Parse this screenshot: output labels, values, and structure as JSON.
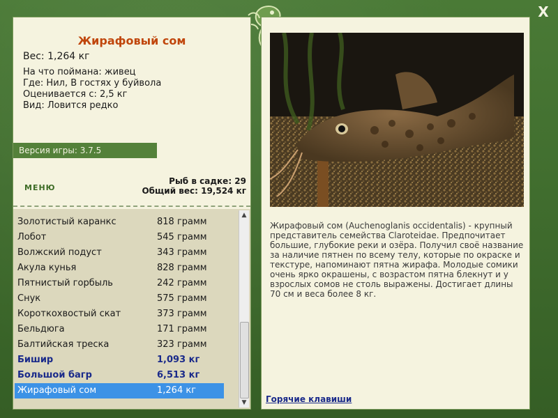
{
  "close_label": "X",
  "fish": {
    "title": "Жирафовый сом",
    "weight": "Вес: 1,264 кг",
    "bait": "На что поймана: живец",
    "location": "Где: Нил, В гостях у буйвола",
    "valued_from": "Оценивается с: 2,5 кг",
    "rarity": "Вид: Ловится редко"
  },
  "version": "Версия игры: 3.7.5",
  "menu_label": "МЕНЮ",
  "stats": {
    "fish_count": "Рыб в садке: 29",
    "total_weight": "Общий вес: 19,524 кг"
  },
  "catch_list": [
    {
      "name": "Золотистый каранкс",
      "weight": "818 грамм",
      "big": false,
      "selected": false
    },
    {
      "name": "Лобот",
      "weight": "545 грамм",
      "big": false,
      "selected": false
    },
    {
      "name": "Волжский подуст",
      "weight": "343 грамм",
      "big": false,
      "selected": false
    },
    {
      "name": "Акула кунья",
      "weight": "828 грамм",
      "big": false,
      "selected": false
    },
    {
      "name": "Пятнистый горбыль",
      "weight": "242 грамм",
      "big": false,
      "selected": false
    },
    {
      "name": "Снук",
      "weight": "575 грамм",
      "big": false,
      "selected": false
    },
    {
      "name": "Короткохвостый скат",
      "weight": "373 грамм",
      "big": false,
      "selected": false
    },
    {
      "name": "Бельдюга",
      "weight": "171 грамм",
      "big": false,
      "selected": false
    },
    {
      "name": "Балтийская треска",
      "weight": "323 грамм",
      "big": false,
      "selected": false
    },
    {
      "name": "Бишир",
      "weight": "1,093 кг",
      "big": true,
      "selected": false
    },
    {
      "name": "Большой багр",
      "weight": "6,513 кг",
      "big": true,
      "selected": false
    },
    {
      "name": "Жирафовый сом",
      "weight": "1,264 кг",
      "big": false,
      "selected": true
    }
  ],
  "description": "Жирафовый сом (Auchenoglanis occidentalis) - крупный представитель семейства Claroteidae. Предпочитает большие, глубокие реки и озёра. Получил своё название за наличие пятнен по всему телу, которые по окраске и текстуре, напоминают пятна жирафа. Молодые сомики очень ярко окрашены, с возрастом пятна блекнут и у взрослых сомов не столь выражены. Достигает длины 70 см и веса более 8 кг.",
  "hotkeys_label": "Горячие клавиши",
  "colors": {
    "frame": "#3f6a2e",
    "panel": "#f5f3df",
    "title": "#c0460c",
    "selection": "#3c92e6",
    "big_catch": "#1a2a8a"
  }
}
